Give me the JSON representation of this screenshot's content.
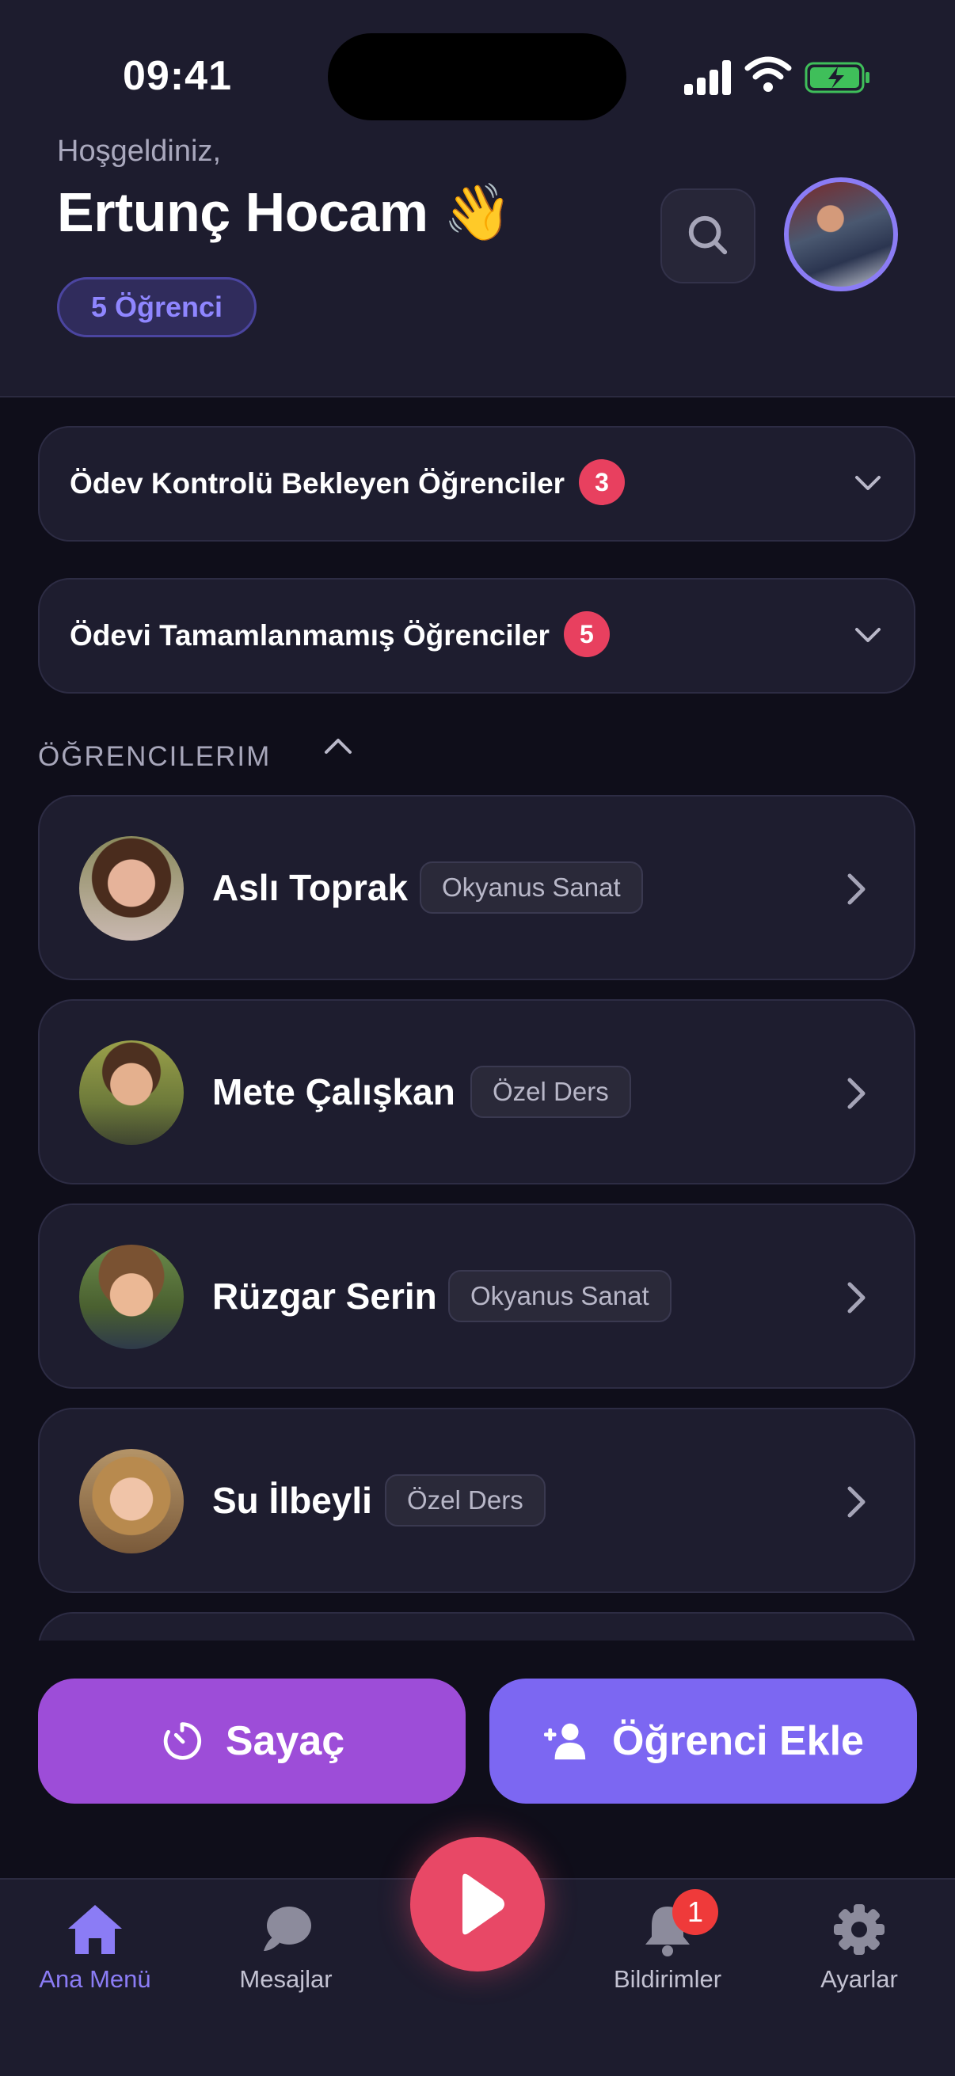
{
  "status_bar": {
    "time": "09:41"
  },
  "header": {
    "welcome": "Hoşgeldiniz,",
    "teacher_name": "Ertunç Hocam 👋",
    "student_count_badge": "5 Öğrenci"
  },
  "accordions": [
    {
      "title": "Ödev Kontrolü Bekleyen Öğrenciler",
      "badge": "3"
    },
    {
      "title": "Ödevi Tamamlanmamış Öğrenciler",
      "badge": "5"
    }
  ],
  "students_section": {
    "label": "ÖĞRENCILERIM"
  },
  "students": [
    {
      "name": "Aslı Toprak",
      "tag": "Okyanus Sanat"
    },
    {
      "name": "Mete Çalışkan",
      "tag": "Özel Ders"
    },
    {
      "name": "Rüzgar Serin",
      "tag": "Okyanus Sanat"
    },
    {
      "name": "Su İlbeyli",
      "tag": "Özel Ders"
    }
  ],
  "actions": {
    "timer_label": "Sayaç",
    "add_student_label": "Öğrenci Ekle"
  },
  "nav": {
    "home": "Ana Menü",
    "messages": "Mesajlar",
    "notifications": "Bildirimler",
    "notifications_count": "1",
    "settings": "Ayarlar"
  },
  "colors": {
    "accent": "#8b7cf5",
    "badge_red": "#e8405f",
    "timer_button": "#9d4dd8",
    "add_button": "#7c67f2",
    "play_button": "#e84866"
  },
  "icons": [
    "search-icon",
    "chevron-down-icon",
    "chevron-up-icon",
    "chevron-right-icon",
    "timer-icon",
    "add-user-icon",
    "home-icon",
    "chat-icon",
    "play-icon",
    "bell-icon",
    "gear-icon"
  ]
}
